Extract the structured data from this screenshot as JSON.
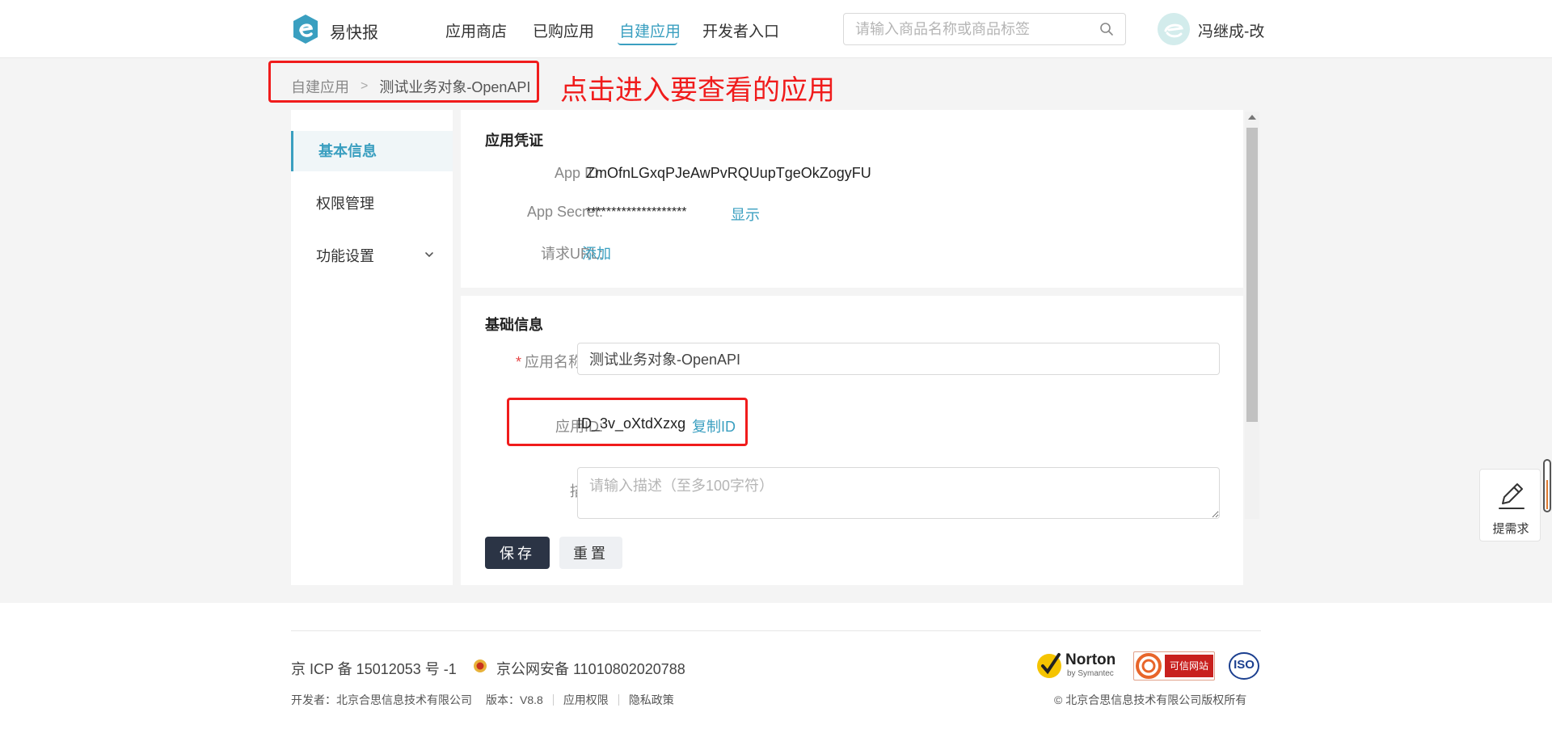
{
  "header": {
    "brand": "易快报",
    "nav": [
      "应用商店",
      "已购应用",
      "自建应用",
      "开发者入口"
    ],
    "active_nav": "自建应用",
    "search_placeholder": "请输入商品名称或商品标签",
    "username": "冯继成-改",
    "accent_color": "#3a9fc0"
  },
  "breadcrumb": {
    "root": "自建应用",
    "separator": ">",
    "current": "测试业务对象-OpenAPI"
  },
  "annotation": "点击进入要查看的应用",
  "sidebar": {
    "items": [
      {
        "label": "基本信息",
        "active": true
      },
      {
        "label": "权限管理",
        "active": false
      },
      {
        "label": "功能设置",
        "active": false,
        "icon": "chevron-down-icon"
      }
    ]
  },
  "credentials": {
    "title": "应用凭证",
    "app_id_label": "App ID:",
    "app_id": "ZmOfnLGxqPJeAwPvRQUupTgeOkZogyFU",
    "secret_label": "App Secret:",
    "secret": "********************",
    "show_link": "显示",
    "url_label": "请求URL:",
    "add_link": "添加"
  },
  "basic_info": {
    "title": "基础信息",
    "name_label": "应用名称:",
    "name_value": "测试业务对象-OpenAPI",
    "app_id_label": "应用ID:",
    "app_id_value": "ID_3v_oXtdXzxg",
    "copy_link": "复制ID",
    "desc_label": "描述:",
    "desc_placeholder": "请输入描述（至多100字符）"
  },
  "actions": {
    "save": "保存",
    "reset": "重置"
  },
  "float_button": {
    "label": "提需求",
    "icon": "pencil-icon"
  },
  "footer": {
    "icp": "京 ICP 备 15012053 号 -1",
    "police": "京公网安备 11010802020788",
    "developer": "开发者：北京合思信息技术有限公司",
    "version": "版本：V8.8",
    "permissions": "应用权限",
    "privacy": "隐私政策",
    "copyright": "© 北京合思信息技术有限公司版权所有",
    "badges": [
      "Norton",
      "by Symantec",
      "可信网站",
      "ISO"
    ]
  },
  "colors": {
    "annotation_red": "#f01c1c",
    "primary_button": "#2b3445"
  }
}
